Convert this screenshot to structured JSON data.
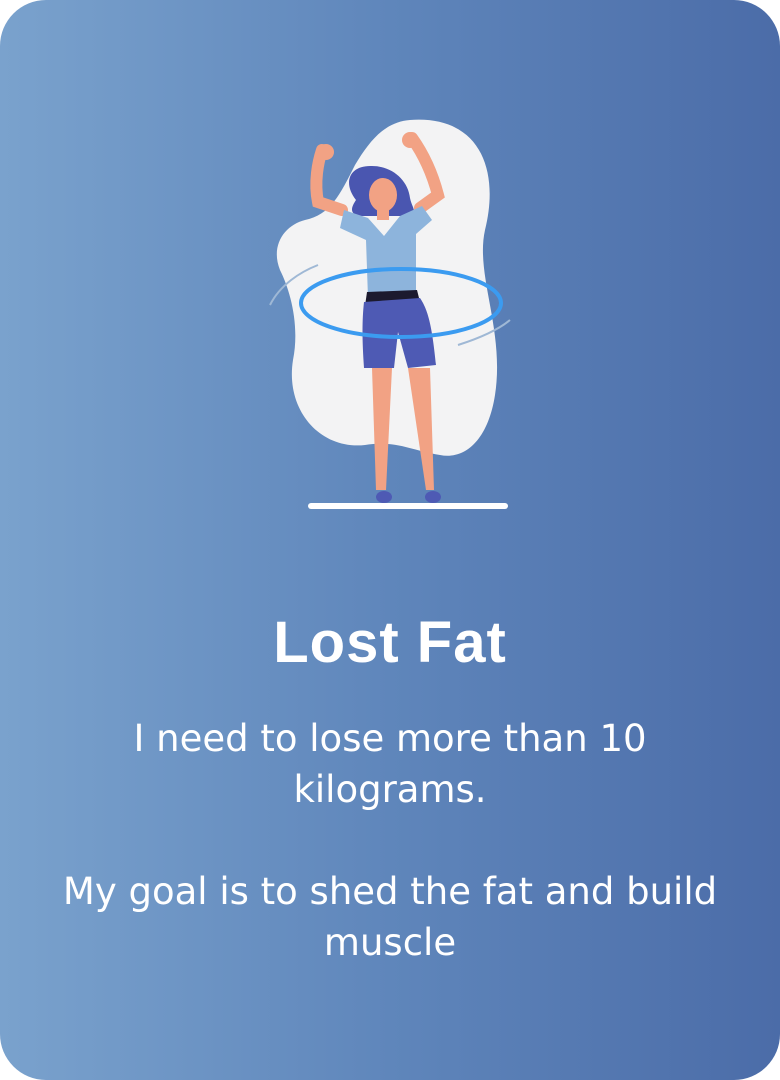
{
  "card": {
    "title": "Lost Fat",
    "description_line1": "I need to lose more than 10 kilograms.",
    "description_line2": "My goal is to shed the fat and build muscle",
    "illustration": "woman-hula-hoop-illustration",
    "colors": {
      "gradient_start": "#7aa2cd",
      "gradient_end": "#4b6ca8",
      "text": "#ffffff",
      "hoop": "#3b9bf0"
    }
  }
}
